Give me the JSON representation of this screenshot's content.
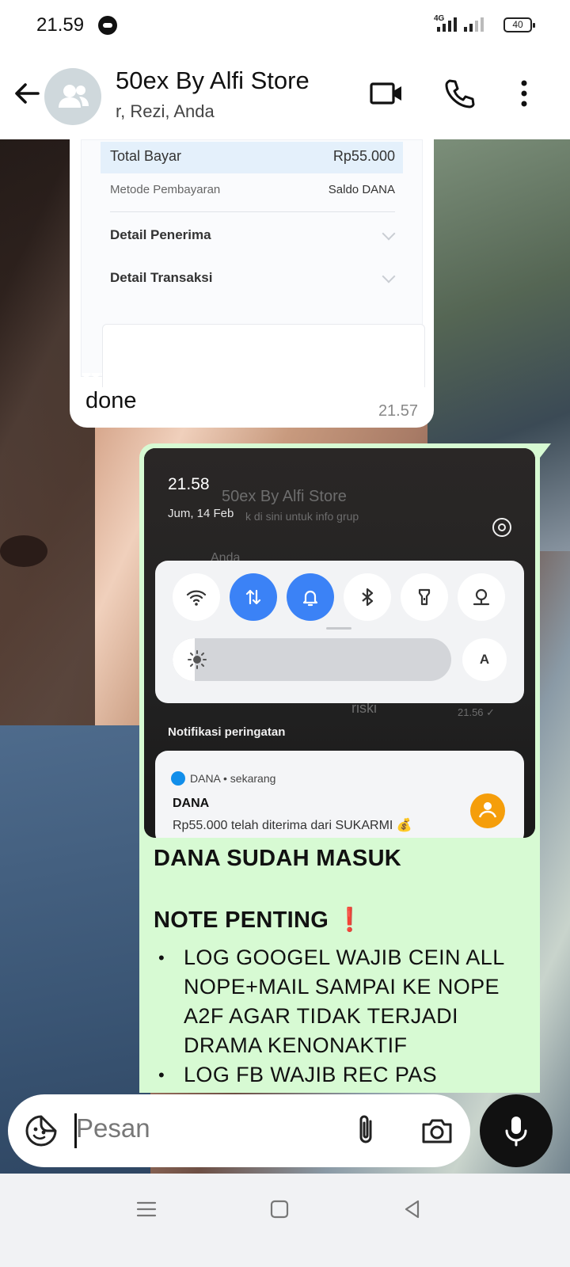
{
  "status_bar": {
    "time": "21.59",
    "network": "4G",
    "battery": "40"
  },
  "header": {
    "title": "50ex By Alfi Store",
    "subtitle": "r, Rezi, Anda"
  },
  "receipt": {
    "total_label": "Total Bayar",
    "total_value": "Rp55.000",
    "method_label": "Metode Pembayaran",
    "method_value": "Saldo DANA",
    "detail_recipient": "Detail Penerima",
    "detail_transaction": "Detail Transaksi"
  },
  "message1": {
    "text": "done",
    "time": "21.57"
  },
  "screenshot": {
    "time": "21.58",
    "date": "Jum, 14 Feb",
    "ghost_title": "50ex By Alfi Store",
    "ghost_sub": "k di sini untuk info grup",
    "ghost_name": "Anda",
    "ghost_msg": "riski",
    "ghost_time": "21.56 ✓",
    "auto_label": "A",
    "brightness_level": 0.08,
    "notif_section": "Notifikasi peringatan",
    "notif_source": "DANA • sekarang",
    "notif_title": "DANA",
    "notif_body": "Rp55.000 telah diterima dari SUKARMI 💰"
  },
  "message2": {
    "headline": "DANA SUDAH MASUK",
    "note": "NOTE PENTING ❗",
    "bullets": [
      "LOG GOOGEL WAJIB CEIN ALL NOPE+MAIL SAMPAI KE NOPE A2F AGAR TIDAK TERJADI DRAMA KENONAKTIF",
      "LOG FB WAJIB REC PAS"
    ]
  },
  "composer": {
    "placeholder": "Pesan"
  },
  "icons": [
    "back-icon",
    "group-avatar-icon",
    "video-call-icon",
    "phone-icon",
    "more-icon",
    "wifi-icon",
    "data-icon",
    "bell-icon",
    "bluetooth-icon",
    "flashlight-icon",
    "location-icon",
    "sticker-icon",
    "attach-icon",
    "camera-icon",
    "mic-icon",
    "menu-icon",
    "home-icon",
    "back-nav-icon"
  ]
}
